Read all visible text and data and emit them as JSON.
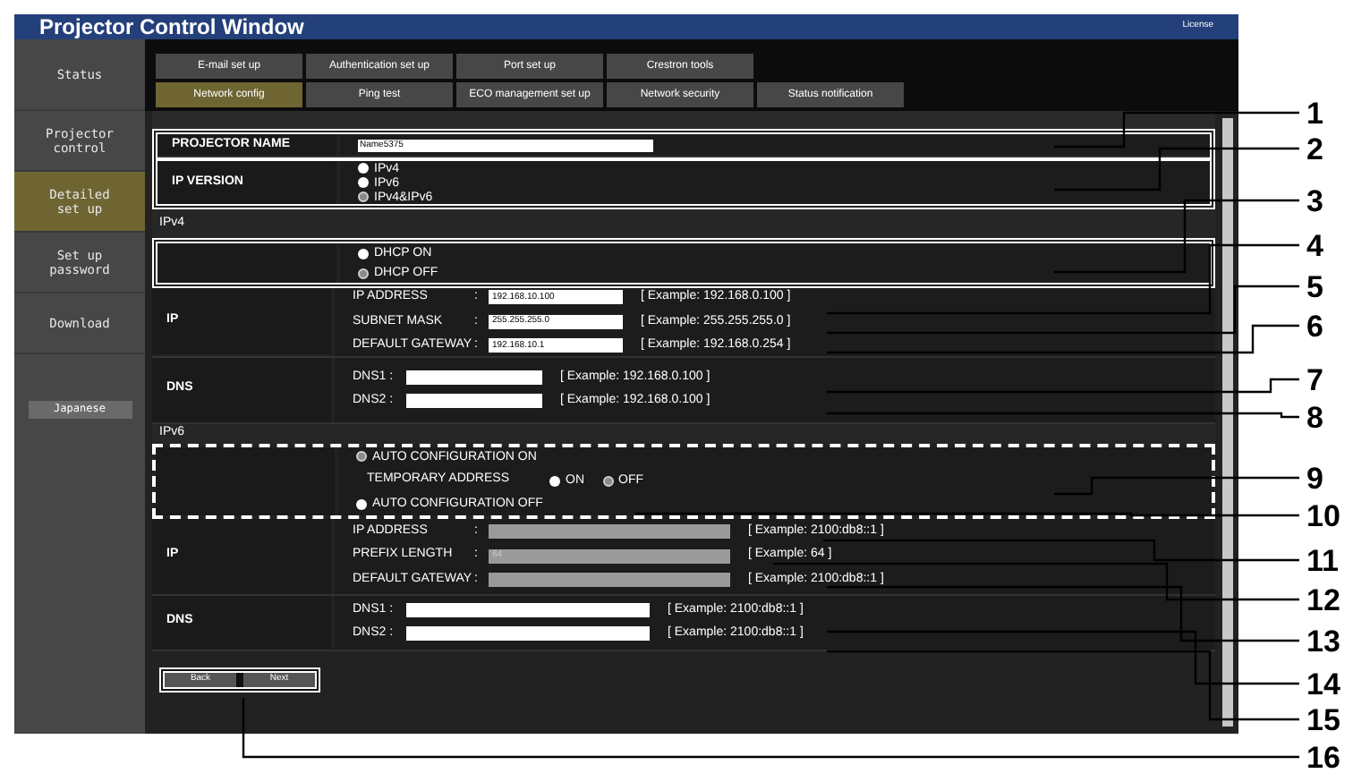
{
  "window": {
    "title": "Projector Control Window",
    "license": "License"
  },
  "sidebar": {
    "items": [
      {
        "label": "Status",
        "selected": false
      },
      {
        "label": "Projector control",
        "selected": false
      },
      {
        "label": "Detailed set up",
        "selected": true
      },
      {
        "label": "Set up password",
        "selected": false
      },
      {
        "label": "Download",
        "selected": false
      }
    ],
    "language_button": "Japanese"
  },
  "tab_rows": [
    [
      {
        "label": "E-mail set up",
        "selected": false
      },
      {
        "label": "Authentication set up",
        "selected": false
      },
      {
        "label": "Port set up",
        "selected": false
      },
      {
        "label": "Crestron tools",
        "selected": false
      }
    ],
    [
      {
        "label": "Network config",
        "selected": true
      },
      {
        "label": "Ping test",
        "selected": false
      },
      {
        "label": "ECO management set up",
        "selected": false
      },
      {
        "label": "Network security",
        "selected": false
      },
      {
        "label": "Status notification",
        "selected": false
      }
    ]
  ],
  "projector_name": {
    "label": "PROJECTOR NAME",
    "value": "Name5375"
  },
  "ip_version": {
    "label": "IP VERSION",
    "options": [
      {
        "label": "IPv4",
        "selected": false
      },
      {
        "label": "IPv6",
        "selected": false
      },
      {
        "label": "IPv4&IPv6",
        "selected": true
      }
    ]
  },
  "ipv4": {
    "heading": "IPv4",
    "dhcp": [
      {
        "label": "DHCP ON",
        "selected": false
      },
      {
        "label": "DHCP OFF",
        "selected": true
      }
    ],
    "ip": {
      "label": "IP",
      "fields": [
        {
          "label": "IP ADDRESS",
          "colon": ":",
          "value": "192.168.10.100",
          "example": "[ Example: 192.168.0.100 ]"
        },
        {
          "label": "SUBNET MASK",
          "colon": ":",
          "value": "255.255.255.0",
          "example": "[ Example: 255.255.255.0 ]"
        },
        {
          "label": "DEFAULT GATEWAY",
          "colon": ":",
          "value": "192.168.10.1",
          "example": "[ Example: 192.168.0.254 ]"
        }
      ]
    },
    "dns": {
      "label": "DNS",
      "fields": [
        {
          "label": "DNS1 :",
          "example": "[ Example: 192.168.0.100 ]"
        },
        {
          "label": "DNS2 :",
          "example": "[ Example: 192.168.0.100 ]"
        }
      ]
    }
  },
  "ipv6": {
    "heading": "IPv6",
    "auto_config": [
      {
        "label": "AUTO CONFIGURATION ON",
        "selected": true
      },
      {
        "label": "AUTO CONFIGURATION OFF",
        "selected": false
      }
    ],
    "temporary_address": {
      "label": "TEMPORARY ADDRESS",
      "options": [
        {
          "label": "ON",
          "selected": false
        },
        {
          "label": "OFF",
          "selected": true
        }
      ]
    },
    "ip": {
      "label": "IP",
      "fields": [
        {
          "label": "IP ADDRESS",
          "colon": ":",
          "disabled": true,
          "example": "[ Example: 2100:db8::1 ]"
        },
        {
          "label": "PREFIX LENGTH",
          "colon": ":",
          "value": "64",
          "disabled": true,
          "example": "[ Example: 64 ]"
        },
        {
          "label": "DEFAULT GATEWAY",
          "colon": ":",
          "disabled": true,
          "example": "[ Example: 2100:db8::1 ]"
        }
      ]
    },
    "dns": {
      "label": "DNS",
      "fields": [
        {
          "label": "DNS1 :",
          "example": "[ Example: 2100:db8::1 ]"
        },
        {
          "label": "DNS2 :",
          "example": "[ Example: 2100:db8::1 ]"
        }
      ]
    }
  },
  "buttons": [
    {
      "label": "Back"
    },
    {
      "label": "Next"
    }
  ],
  "callouts": [
    "1",
    "2",
    "3",
    "4",
    "5",
    "6",
    "7",
    "8",
    "9",
    "10",
    "11",
    "12",
    "13",
    "14",
    "15",
    "16"
  ]
}
